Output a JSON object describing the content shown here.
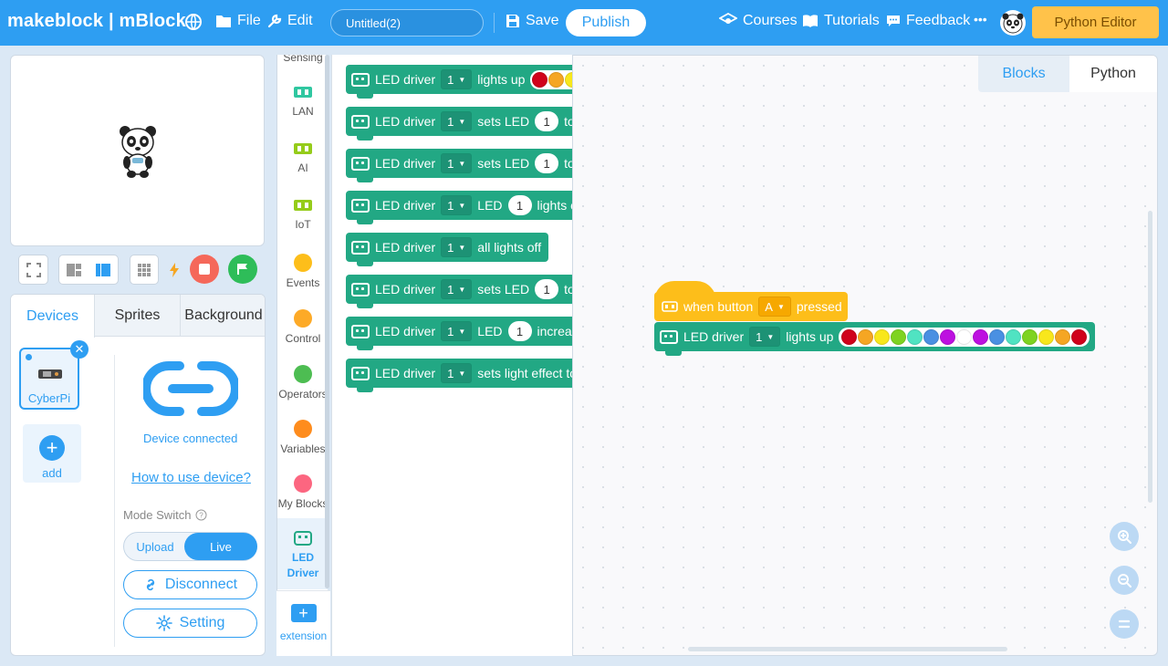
{
  "header": {
    "brand": "makeblock | mBlock",
    "file": "File",
    "edit": "Edit",
    "project_title": "Untitled(2)",
    "save": "Save",
    "publish": "Publish",
    "courses": "Courses",
    "tutorials": "Tutorials",
    "feedback": "Feedback",
    "more": "•••",
    "python_editor": "Python Editor"
  },
  "device_panel": {
    "tabs": [
      "Devices",
      "Sprites",
      "Background"
    ],
    "active_tab": "Devices",
    "device_name": "CyberPi",
    "add_label": "add",
    "status": "Device connected",
    "how_to": "How to use device?",
    "mode_label": "Mode Switch",
    "mode_upload": "Upload",
    "mode_live": "Live",
    "disconnect": "Disconnect",
    "setting": "Setting"
  },
  "categories": {
    "partial_top": "Sensing",
    "items": [
      {
        "label": "LAN",
        "color": "#2fc7a0"
      },
      {
        "label": "AI",
        "color": "#95cc1a"
      },
      {
        "label": "IoT",
        "color": "#95cc1a"
      },
      {
        "label": "Events",
        "color": "#fdbe1a"
      },
      {
        "label": "Control",
        "color": "#fdaa27"
      },
      {
        "label": "Operators",
        "color": "#4dbd52"
      },
      {
        "label": "Variables",
        "color": "#fe8c1d"
      },
      {
        "label": "My Blocks",
        "color": "#fc6680"
      }
    ],
    "active": "LED Driver",
    "active_line1": "LED",
    "active_line2": "Driver",
    "extension": "extension"
  },
  "palette": {
    "blocks": [
      {
        "label": "LED driver",
        "port": "1",
        "text": "lights up"
      },
      {
        "label": "LED driver",
        "port": "1",
        "text": "sets LED",
        "led": "1",
        "tail": "to"
      },
      {
        "label": "LED driver",
        "port": "1",
        "text": "sets LED",
        "led": "1",
        "tail": "to R"
      },
      {
        "label": "LED driver",
        "port": "1",
        "text": "LED",
        "led": "1",
        "tail": "lights of"
      },
      {
        "label": "LED driver",
        "port": "1",
        "text": "all lights off"
      },
      {
        "label": "LED driver",
        "port": "1",
        "text": "sets LED",
        "led": "1",
        "tail": "to"
      },
      {
        "label": "LED driver",
        "port": "1",
        "text": "LED",
        "led": "1",
        "tail": "increase"
      },
      {
        "label": "LED driver",
        "port": "1",
        "text": "sets light effect to"
      }
    ],
    "first_block_colors": [
      "#d0021b",
      "#f5a623",
      "#f8e71c"
    ],
    "second_block_color": "#d0021b"
  },
  "workspace": {
    "tabs": [
      "Blocks",
      "Python"
    ],
    "active_tab": "Blocks",
    "hat": {
      "prefix": "when button",
      "button": "A",
      "suffix": "pressed"
    },
    "command": {
      "label": "LED driver",
      "port": "1",
      "text": "lights up",
      "colors": [
        "#d0021b",
        "#f5a623",
        "#f8e71c",
        "#7ed321",
        "#50e3c2",
        "#4a90e2",
        "#bd10e0",
        "#ffffff",
        "#bd10e0",
        "#4a90e2",
        "#50e3c2",
        "#7ed321",
        "#f8e71c",
        "#f5a623",
        "#d0021b"
      ]
    }
  }
}
